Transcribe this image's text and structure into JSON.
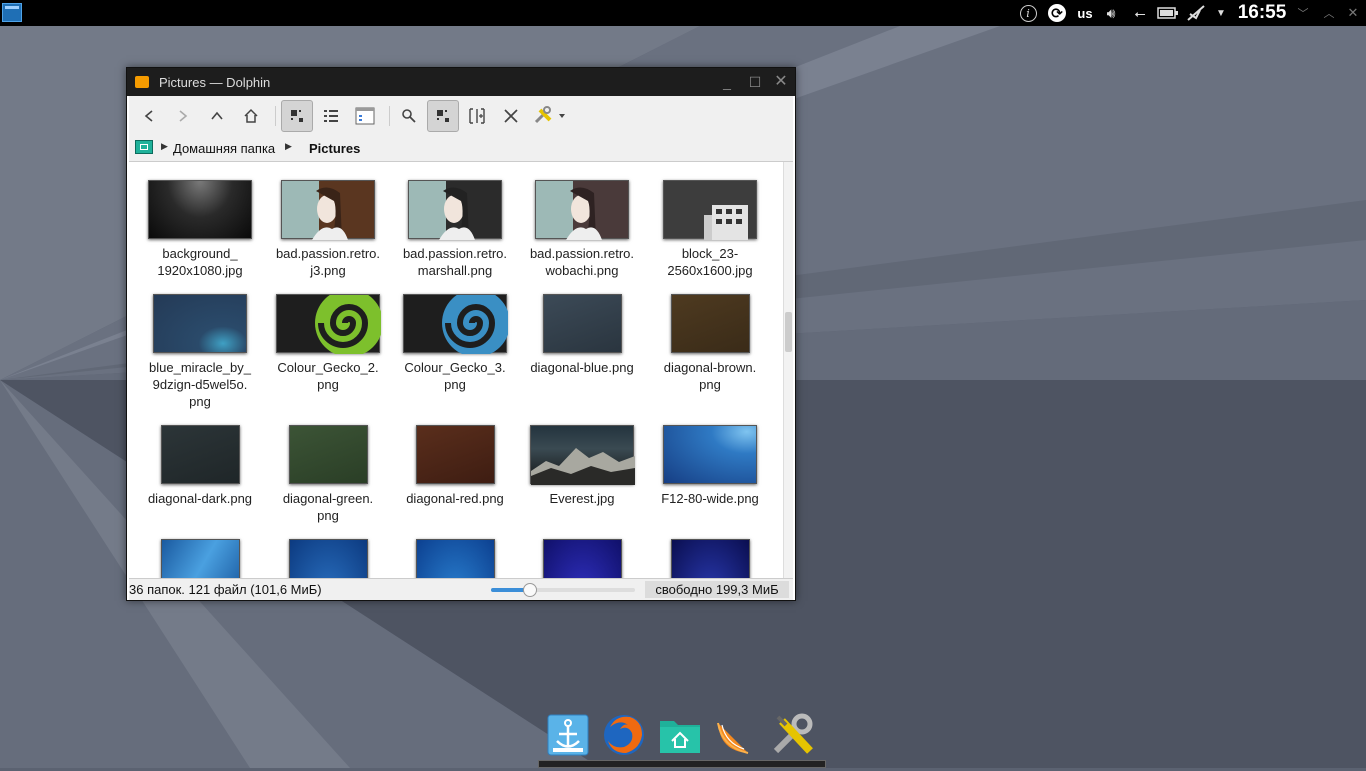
{
  "topbar": {
    "layout": "us",
    "clock": "16:55"
  },
  "window": {
    "title": "Pictures — Dolphin",
    "breadcrumb": [
      "Домашняя папка",
      "Pictures"
    ],
    "status": "36 папок. 121 файл (101,6 МиБ)",
    "free_space": "свободно 199,3 МиБ",
    "zoom_fraction": 0.27
  },
  "files": [
    {
      "name": "background_\n1920x1080.jpg"
    },
    {
      "name": "bad.passion.retro.\nj3.png"
    },
    {
      "name": "bad.passion.retro.\nmarshall.png"
    },
    {
      "name": "bad.passion.retro.\nwobachi.png"
    },
    {
      "name": "block_23-\n2560x1600.jpg"
    },
    {
      "name": "blue_miracle_by_\n9dzign-d5wel5o.\npng"
    },
    {
      "name": "Colour_Gecko_2.\npng"
    },
    {
      "name": "Colour_Gecko_3.\npng"
    },
    {
      "name": "diagonal-blue.png"
    },
    {
      "name": "diagonal-brown.\npng"
    },
    {
      "name": "diagonal-dark.png"
    },
    {
      "name": "diagonal-green.\npng"
    },
    {
      "name": "diagonal-red.png"
    },
    {
      "name": "Everest.jpg"
    },
    {
      "name": "F12-80-wide.png"
    }
  ]
}
